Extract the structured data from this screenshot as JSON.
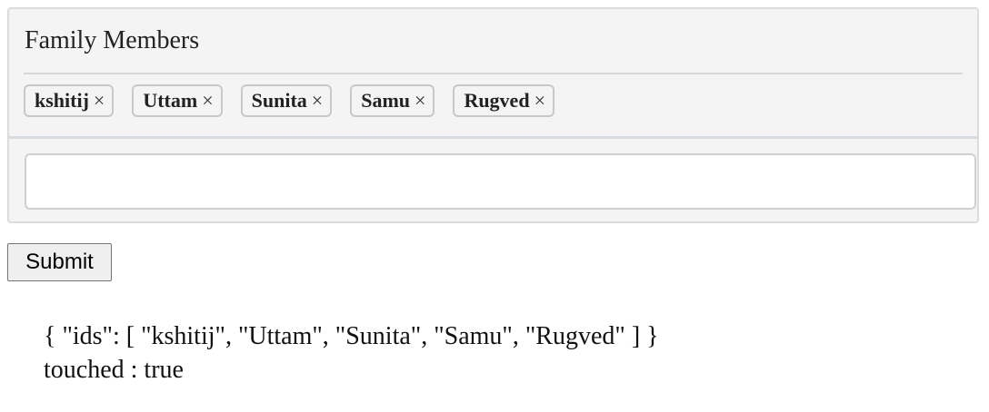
{
  "form": {
    "title": "Family Members",
    "chips": [
      {
        "label": "kshitij",
        "remove": "×"
      },
      {
        "label": "Uttam",
        "remove": "×"
      },
      {
        "label": "Sunita",
        "remove": "×"
      },
      {
        "label": "Samu",
        "remove": "×"
      },
      {
        "label": "Rugved",
        "remove": "×"
      }
    ],
    "input": {
      "value": "",
      "placeholder": ""
    }
  },
  "actions": {
    "submit_label": "Submit"
  },
  "output": {
    "json_line": "{ \"ids\": [ \"kshitij\", \"Uttam\", \"Sunita\", \"Samu\", \"Rugved\" ] }",
    "touched_line": "touched : true"
  }
}
